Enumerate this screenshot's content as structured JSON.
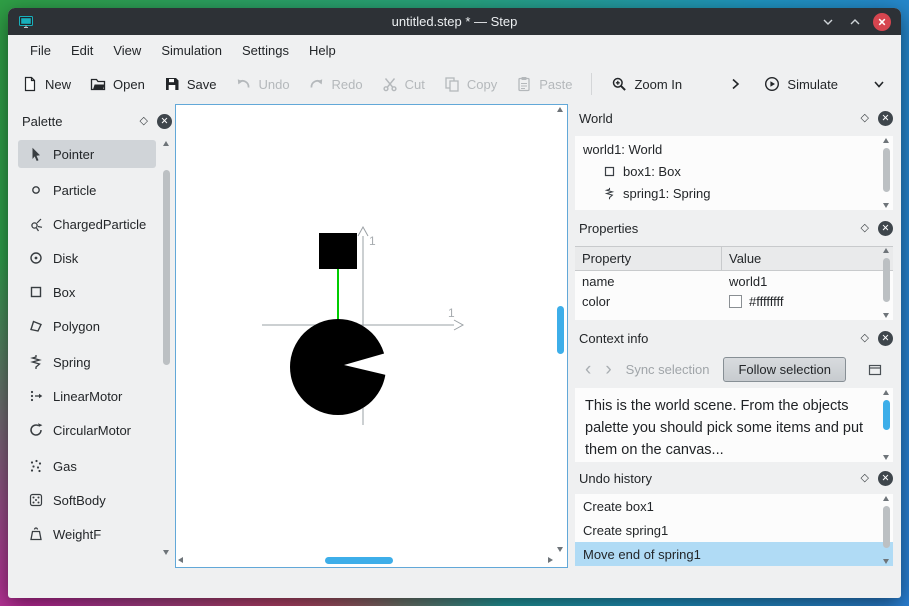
{
  "window": {
    "title": "untitled.step * — Step"
  },
  "menubar": {
    "items": [
      "File",
      "Edit",
      "View",
      "Simulation",
      "Settings",
      "Help"
    ]
  },
  "toolbar": {
    "new": "New",
    "open": "Open",
    "save": "Save",
    "undo": "Undo",
    "redo": "Redo",
    "cut": "Cut",
    "copy": "Copy",
    "paste": "Paste",
    "zoom_in": "Zoom In",
    "simulate": "Simulate"
  },
  "palette": {
    "title": "Palette",
    "items": [
      {
        "label": "Pointer",
        "selected": true
      },
      {
        "label": "Particle",
        "selected": false
      },
      {
        "label": "ChargedParticle",
        "selected": false
      },
      {
        "label": "Disk",
        "selected": false
      },
      {
        "label": "Box",
        "selected": false
      },
      {
        "label": "Polygon",
        "selected": false
      },
      {
        "label": "Spring",
        "selected": false
      },
      {
        "label": "LinearMotor",
        "selected": false
      },
      {
        "label": "CircularMotor",
        "selected": false
      },
      {
        "label": "Gas",
        "selected": false
      },
      {
        "label": "SoftBody",
        "selected": false
      },
      {
        "label": "WeightF",
        "selected": false,
        "clipped": true
      }
    ]
  },
  "scene": {
    "x_axis_label": "1",
    "y_axis_label": "1"
  },
  "world_panel": {
    "title": "World",
    "items": [
      {
        "label": "world1: World",
        "indent": 0
      },
      {
        "label": "box1: Box",
        "indent": 1
      },
      {
        "label": "spring1: Spring",
        "indent": 1
      }
    ]
  },
  "properties_panel": {
    "title": "Properties",
    "columns": [
      "Property",
      "Value"
    ],
    "rows": [
      {
        "property": "name",
        "value": "world1"
      },
      {
        "property": "color",
        "value": "#ffffffff",
        "swatch": "#ffffff"
      }
    ]
  },
  "context_panel": {
    "title": "Context info",
    "sync_label": "Sync selection",
    "follow_label": "Follow selection",
    "body": "This is the world scene. From the objects palette you should pick some items and put them on the canvas..."
  },
  "undo_panel": {
    "title": "Undo history",
    "items": [
      {
        "label": "Create box1",
        "selected": false
      },
      {
        "label": "Create spring1",
        "selected": false
      },
      {
        "label": "Move end of spring1",
        "selected": true
      }
    ]
  },
  "colors": {
    "accent": "#3daee9",
    "selection_blue": "#b0dbf5",
    "spring_green": "#00cc00",
    "titlebar_bg": "#2d3136",
    "close_red": "#d6454f",
    "window_bg": "#eff0f1",
    "canvas_border": "#62a8d8"
  }
}
